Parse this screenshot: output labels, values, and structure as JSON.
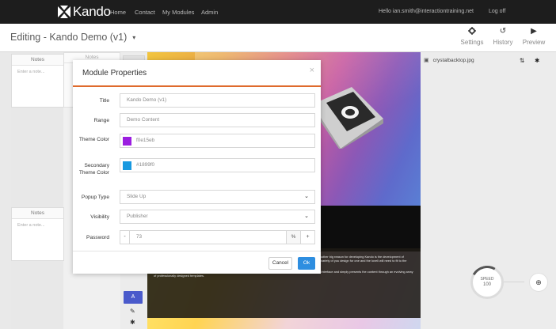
{
  "brand": {
    "name": "Kando"
  },
  "nav": {
    "links": [
      "Home",
      "Contact",
      "My Modules",
      "Admin"
    ],
    "user_greeting": "Hello ian.smith@interactiontraining.net",
    "logout": "Log off"
  },
  "editbar": {
    "title": "Editing - Kando Demo (v1)",
    "tools": [
      {
        "label": "Settings",
        "icon": "gear-icon"
      },
      {
        "label": "History",
        "icon": "history-icon"
      },
      {
        "label": "Preview",
        "icon": "play-icon"
      }
    ]
  },
  "notes": {
    "panels": [
      {
        "title": "Notes",
        "placeholder": "Enter a note..."
      },
      {
        "title": "Notes",
        "placeholder": "Enter a note..."
      }
    ],
    "col2_title": "Notes"
  },
  "modal": {
    "title": "Module Properties",
    "fields": {
      "title": {
        "label": "Title",
        "value": "Kando Demo (v1)"
      },
      "range": {
        "label": "Range",
        "value": "Demo Content"
      },
      "theme_color": {
        "label": "Theme Color",
        "value": "f0e15eb",
        "color": "#9b1ee0"
      },
      "secondary_theme_color": {
        "label": "Secondary Theme Color",
        "value": "#1899f0",
        "color": "#1899e0"
      },
      "popup_type": {
        "label": "Popup Type",
        "value": "Slide Up"
      },
      "visibility": {
        "label": "Visibility",
        "value": "Publisher"
      },
      "password": {
        "label": "Password",
        "value": "73",
        "minus": "-",
        "suffix": "%",
        "plus": "+"
      }
    },
    "cancel_label": "Cancel",
    "ok_label": "Ok"
  },
  "slide": {
    "paragraphs": [
      "ible to anybody with minimal training but not limit the quality of the output by the authors' technical or design experience. Another big reason for developing Kando is the development of content that is mobile compliant. Of course, a lot of the DIY devices and authoring tools claim this but they have adopted a variety of you design for one and the loveli will need to fit to the other (with varying but never optimal degree of success).",
      "Kando deliberately separates the content assets (the images, audio, text, questions, quizzes, video's, etc) from the staging interface and simply presents the content through an evolving array of professionally designed templates."
    ],
    "a_button": "A"
  },
  "layers": {
    "file_name": "crystalbacktop.jpg"
  },
  "speed": {
    "label": "SPEED",
    "value": "100"
  },
  "colors": {
    "accent_orange": "#df6a2c",
    "primary_blue": "#2e8ee0",
    "nav_bg": "#1d1d1d"
  }
}
